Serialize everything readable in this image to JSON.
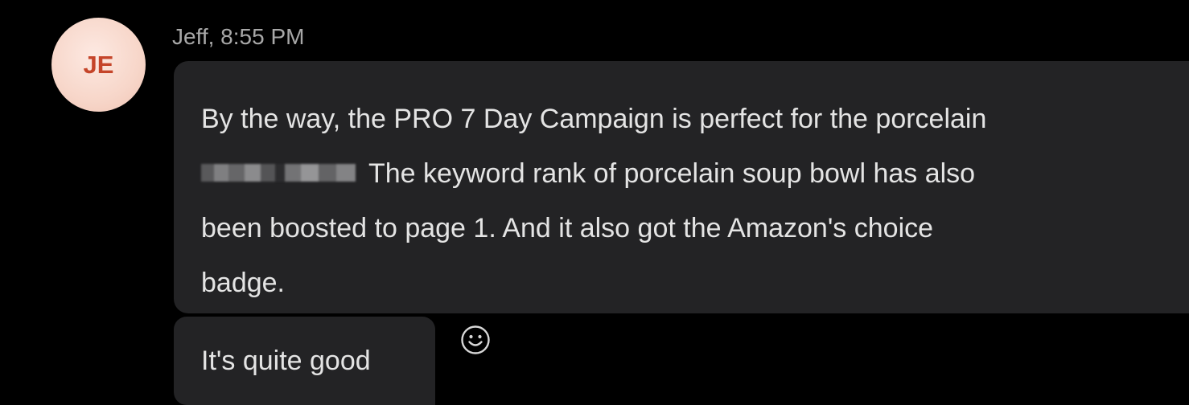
{
  "sender": {
    "initials": "JE",
    "name_time": "Jeff, 8:55 PM"
  },
  "messages": [
    {
      "lines": [
        "By the way, the PRO 7 Day Campaign is perfect for the porcelain",
        "The keyword rank of porcelain soup bowl has also",
        "been boosted to page 1. And it also got the Amazon's choice",
        "badge."
      ],
      "redacted_before_line": 1
    },
    {
      "text": "It's quite good"
    }
  ],
  "icons": {
    "reaction": "smiley-face-icon"
  },
  "colors": {
    "background": "#000000",
    "bubble": "#232325",
    "text": "#e4e4e4",
    "meta": "#a8a8a8",
    "avatar_bg": "#f7d6c9",
    "avatar_text": "#c5452a"
  }
}
